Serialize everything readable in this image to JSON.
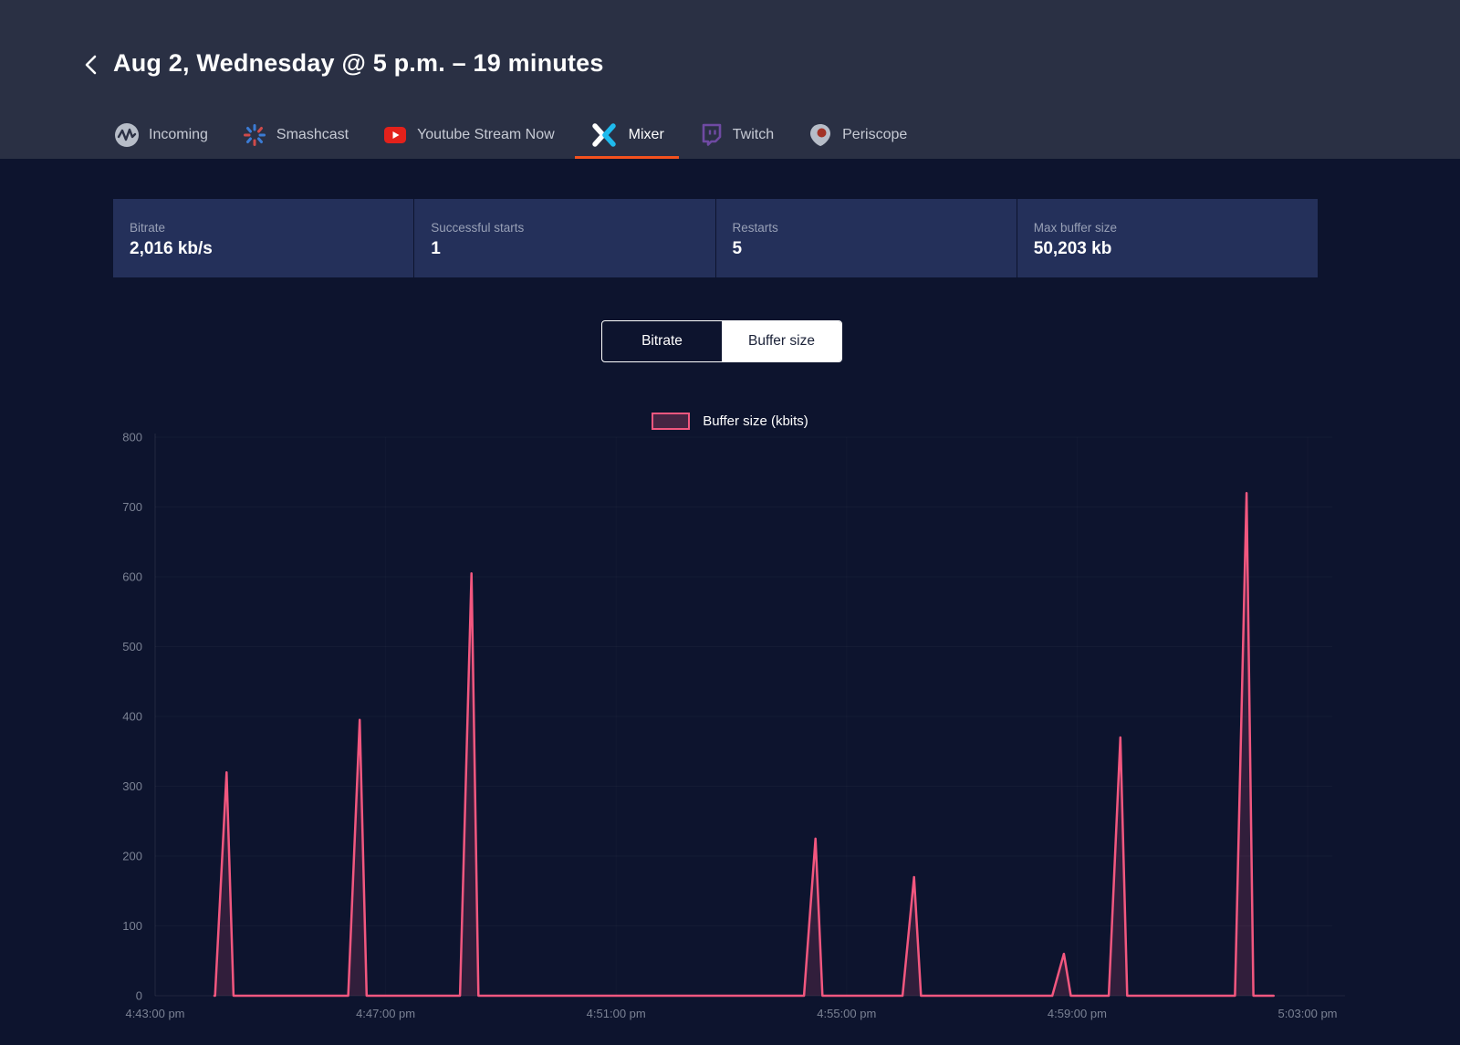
{
  "header": {
    "title": "Aug 2, Wednesday @ 5 p.m. – 19 minutes",
    "back_icon": "chevron-left",
    "tabs": [
      {
        "label": "Incoming",
        "icon": "incoming-waveform-icon",
        "active": false
      },
      {
        "label": "Smashcast",
        "icon": "smashcast-burst-icon",
        "active": false
      },
      {
        "label": "Youtube Stream Now",
        "icon": "youtube-play-icon",
        "active": false
      },
      {
        "label": "Mixer",
        "icon": "mixer-x-icon",
        "active": true
      },
      {
        "label": "Twitch",
        "icon": "twitch-glitch-icon",
        "active": false
      },
      {
        "label": "Periscope",
        "icon": "periscope-pin-icon",
        "active": false
      }
    ],
    "active_tab_underline_color": "#f4511e"
  },
  "stats": [
    {
      "label": "Bitrate",
      "value": "2,016 kb/s"
    },
    {
      "label": "Successful starts",
      "value": "1"
    },
    {
      "label": "Restarts",
      "value": "5"
    },
    {
      "label": "Max buffer size",
      "value": "50,203 kb"
    }
  ],
  "toggle": {
    "options": [
      {
        "label": "Bitrate",
        "selected": false
      },
      {
        "label": "Buffer size",
        "selected": true
      }
    ]
  },
  "legend": {
    "label": "Buffer size (kbits)",
    "swatch_color": "#f2577f"
  },
  "chart_data": {
    "type": "area",
    "title": "Buffer size over time",
    "series_name": "Buffer size (kbits)",
    "x_axis": {
      "start_time": "4:43:00 pm",
      "tick_labels": [
        "4:43:00 pm",
        "4:47:00 pm",
        "4:51:00 pm",
        "4:55:00 pm",
        "4:59:00 pm",
        "5:03:00 pm"
      ],
      "tick_interval_min": 4,
      "span_min": 20.4
    },
    "y_axis": {
      "min": 0,
      "max": 800,
      "tick_step": 100,
      "tick_labels": [
        "0",
        "100",
        "200",
        "300",
        "400",
        "500",
        "600",
        "700",
        "800"
      ]
    },
    "line": {
      "starts_at_min": 1.03,
      "ends_at_min": 19.41,
      "baseline_value": 0
    },
    "spikes": [
      {
        "time": "4:44:14 pm",
        "t_min": 1.24,
        "value": 320
      },
      {
        "time": "4:46:33 pm",
        "t_min": 3.55,
        "value": 395
      },
      {
        "time": "4:48:29 pm",
        "t_min": 5.49,
        "value": 605
      },
      {
        "time": "4:54:28 pm",
        "t_min": 11.46,
        "value": 225
      },
      {
        "time": "4:56:10 pm",
        "t_min": 13.17,
        "value": 170
      },
      {
        "time": "4:58:46 pm",
        "t_min": 15.77,
        "value": 60
      },
      {
        "time": "4:59:45 pm",
        "t_min": 16.75,
        "value": 370
      },
      {
        "time": "5:01:56 pm",
        "t_min": 18.94,
        "value": 720
      }
    ],
    "legend_position": "top-center",
    "grid": "faint",
    "colors": {
      "line": "#f2577f",
      "fill": "rgba(242,87,131,0.16)",
      "axis_text": "#7b8294"
    }
  }
}
